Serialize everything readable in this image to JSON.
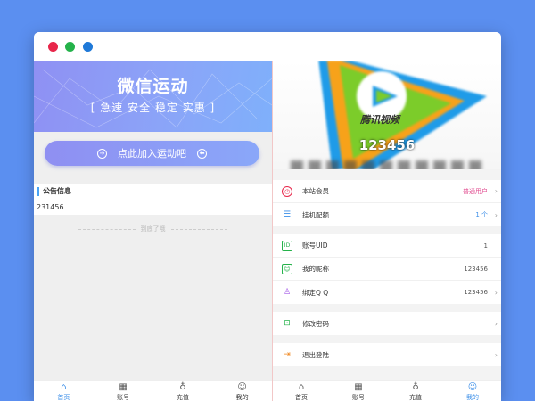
{
  "left": {
    "banner": {
      "title": "微信运动",
      "subtitle": "[ 急速 安全 稳定 实惠 ]"
    },
    "join_button": "点此加入运动吧",
    "notice": {
      "heading": "公告信息",
      "content": "231456"
    },
    "end_text": "到底了哦"
  },
  "right": {
    "hero": {
      "logo_text": "腾讯视频",
      "account_number": "123456"
    },
    "groups": [
      [
        {
          "label": "本站会员",
          "value": "普通用户",
          "icon": "member-icon"
        },
        {
          "label": "挂机配额",
          "value": "1 个",
          "icon": "database-icon"
        }
      ],
      [
        {
          "label": "账号UID",
          "value": "1",
          "icon": "id-card-icon"
        },
        {
          "label": "我的昵称",
          "value": "123456",
          "icon": "profile-icon"
        },
        {
          "label": "绑定Q Q",
          "value": "123456",
          "icon": "qq-icon"
        }
      ],
      [
        {
          "label": "修改密码",
          "icon": "lock-icon"
        }
      ],
      [
        {
          "label": "退出登陆",
          "icon": "logout-icon"
        }
      ]
    ]
  },
  "tabs": [
    {
      "label": "首页",
      "icon": "home-icon"
    },
    {
      "label": "账号",
      "icon": "account-grid-icon"
    },
    {
      "label": "充值",
      "icon": "recharge-icon"
    },
    {
      "label": "我的",
      "icon": "user-icon"
    }
  ],
  "colors": {
    "background": "#5b8ff0",
    "banner_gradient_start": "#8f90f3",
    "banner_gradient_end": "#7fb0fb",
    "tab_active": "#3d8fe8",
    "member_pink": "#e0468c",
    "icon_red": "#e8264a",
    "icon_blue": "#3d8fe8",
    "icon_green": "#24b24a",
    "icon_purple": "#a55be8",
    "icon_orange": "#f08a24"
  }
}
